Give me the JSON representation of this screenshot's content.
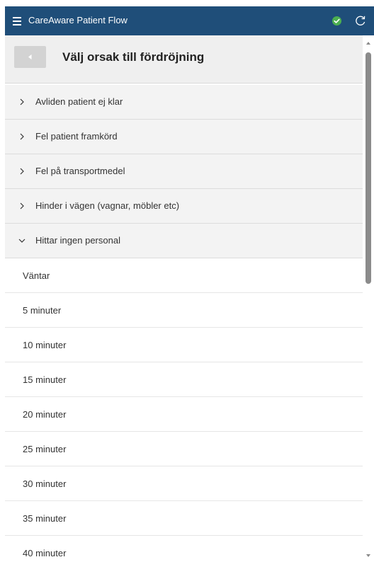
{
  "app": {
    "title": "CareAware Patient Flow",
    "accent_color": "#1f4e79",
    "status_icon": "check-circle-icon",
    "status_color": "#4caf50"
  },
  "header": {
    "title": "Välj orsak till fördröjning"
  },
  "categories": [
    {
      "label": "Avliden patient ej klar",
      "expanded": false
    },
    {
      "label": "Fel patient framkörd",
      "expanded": false
    },
    {
      "label": "Fel på transportmedel",
      "expanded": false
    },
    {
      "label": "Hinder i vägen (vagnar, möbler etc)",
      "expanded": false
    },
    {
      "label": "Hittar ingen personal",
      "expanded": true
    }
  ],
  "sub_options": [
    "Väntar",
    "5 minuter",
    "10 minuter",
    "15 minuter",
    "20 minuter",
    "25 minuter",
    "30 minuter",
    "35 minuter",
    "40 minuter"
  ]
}
